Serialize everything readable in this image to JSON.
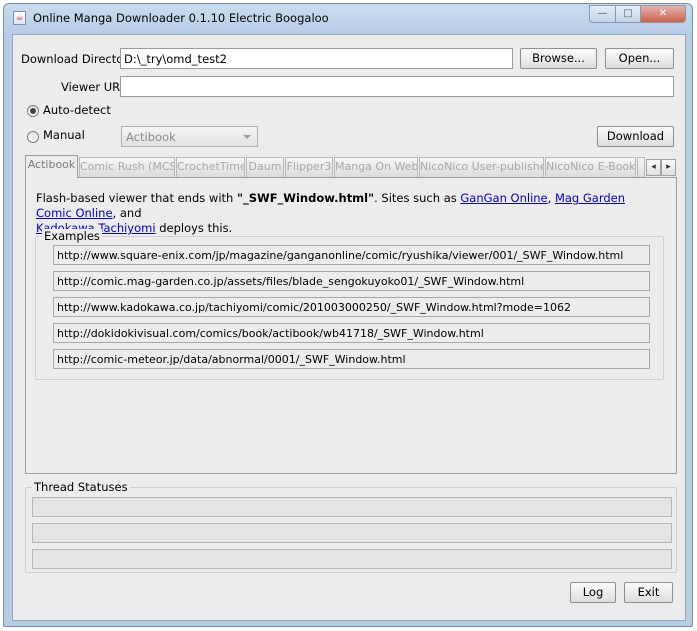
{
  "window": {
    "title": "Online Manga Downloader 0.1.10 Electric Boogaloo",
    "controls": {
      "minimize": "—",
      "maximize": "□",
      "close": "✕"
    }
  },
  "download_directory": {
    "label": "Download Directory",
    "value": "D:\\_try\\omd_test2",
    "browse_label": "Browse...",
    "open_label": "Open..."
  },
  "viewer_url": {
    "label": "Viewer URL",
    "value": ""
  },
  "mode": {
    "auto_detect_label": "Auto-detect",
    "manual_label": "Manual",
    "selected": "auto",
    "manual_selection": "Actibook",
    "download_label": "Download"
  },
  "tabs": [
    {
      "label": "Actibook",
      "active": true
    },
    {
      "label": "Comic Rush (MCS)",
      "active": false
    },
    {
      "label": "CrochetTime",
      "active": false
    },
    {
      "label": "Daum",
      "active": false
    },
    {
      "label": "Flipper3",
      "active": false
    },
    {
      "label": "Manga On Web",
      "active": false
    },
    {
      "label": "NicoNico User-published",
      "active": false
    },
    {
      "label": "NicoNico E-Books",
      "active": false
    }
  ],
  "tab_scroll": {
    "left": "◂",
    "right": "▸"
  },
  "actibook_panel": {
    "desc_prefix": "Flash-based viewer that ends with ",
    "desc_bold": "\"_SWF_Window.html\"",
    "desc_mid": ". Sites such as ",
    "link1": "GanGan Online",
    "sep1": ", ",
    "link2": "Mag Garden Comic Online",
    "sep2": ", and",
    "link3": "Kadokawa Tachiyomi",
    "desc_suffix": " deploys this.",
    "examples_label": "Examples",
    "examples": [
      "http://www.square-enix.com/jp/magazine/ganganonline/comic/ryushika/viewer/001/_SWF_Window.html",
      "http://comic.mag-garden.co.jp/assets/files/blade_sengokuyoko01/_SWF_Window.html",
      "http://www.kadokawa.co.jp/tachiyomi/comic/201003000250/_SWF_Window.html?mode=1062",
      "http://dokidokivisual.com/comics/book/actibook/wb41718/_SWF_Window.html",
      "http://comic-meteor.jp/data/abnormal/0001/_SWF_Window.html"
    ]
  },
  "thread_statuses": {
    "label": "Thread Statuses",
    "bars": [
      "",
      "",
      ""
    ]
  },
  "footer": {
    "log_label": "Log",
    "exit_label": "Exit"
  }
}
